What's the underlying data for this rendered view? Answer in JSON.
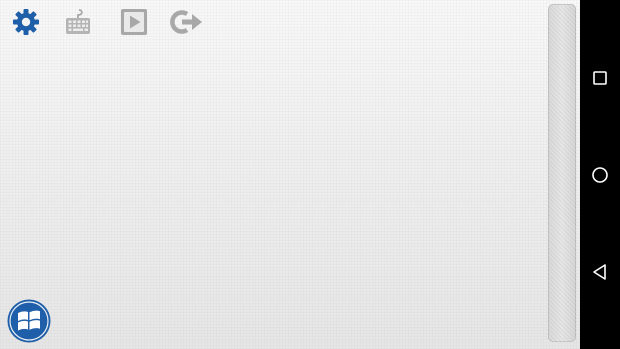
{
  "app": {
    "toolbar": {
      "settings": {
        "icon": "gear-icon",
        "color": "#1f5ea8"
      },
      "keyboard": {
        "icon": "keyboard-icon",
        "color": "#a8a8a8"
      },
      "play": {
        "icon": "play-icon",
        "color": "#a8a8a8"
      },
      "exit": {
        "icon": "exit-icon",
        "color": "#a8a8a8"
      }
    },
    "start_button": {
      "icon": "windows-logo-icon",
      "color": "#1f5ea8"
    }
  },
  "navigation_bar": {
    "buttons": [
      {
        "icon": "recents-square-icon"
      },
      {
        "icon": "home-circle-icon"
      },
      {
        "icon": "back-triangle-icon"
      }
    ],
    "color": "#ffffff"
  }
}
